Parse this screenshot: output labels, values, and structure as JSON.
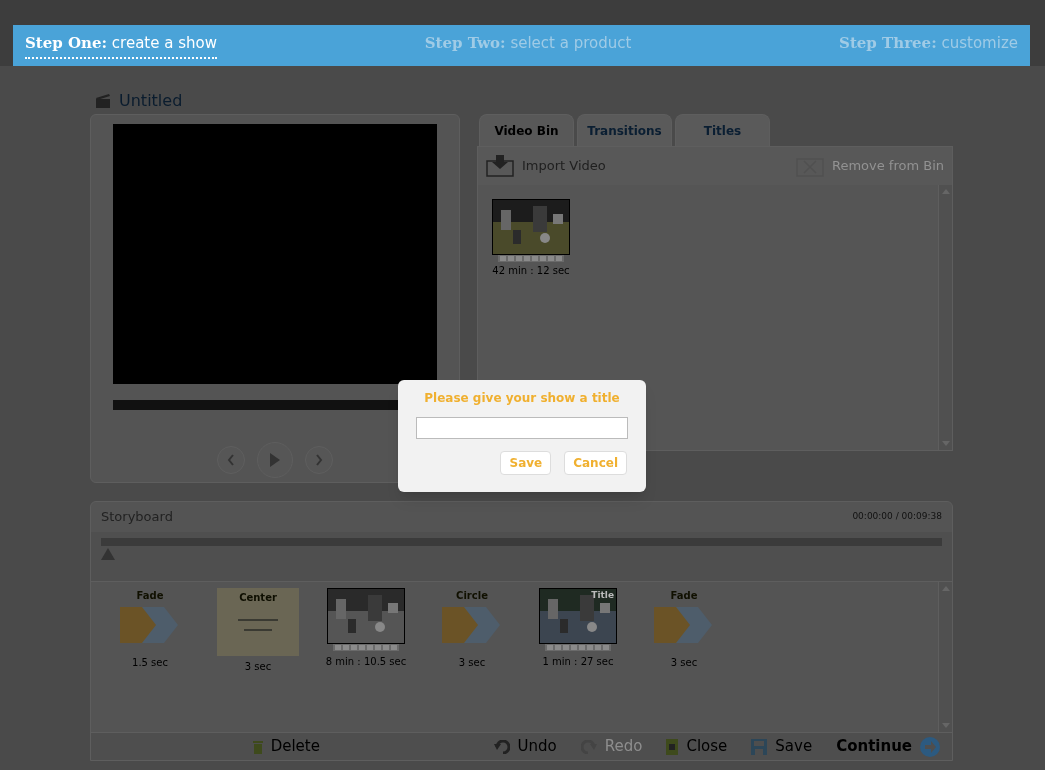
{
  "steps": [
    {
      "label": "Step One:",
      "detail": "create a show",
      "selected": true
    },
    {
      "label": "Step Two:",
      "detail": "select a product",
      "selected": false
    },
    {
      "label": "Step Three:",
      "detail": "customize",
      "selected": false
    }
  ],
  "show_title": "Untitled",
  "tabs": [
    {
      "label": "Video Bin",
      "selected": true
    },
    {
      "label": "Transitions",
      "selected": false
    },
    {
      "label": "Titles",
      "selected": false
    }
  ],
  "bin_toolbar": {
    "import": {
      "label": "Import Video",
      "disabled": false
    },
    "remove": {
      "label": "Remove from Bin",
      "disabled": true
    }
  },
  "bin_clips": [
    {
      "duration": "42 min : 12 sec"
    }
  ],
  "storyboard": {
    "title": "Storyboard",
    "time": "00:00:00 / 00:09:38",
    "items": [
      {
        "kind": "transition",
        "name": "Fade",
        "duration": "1.5 sec"
      },
      {
        "kind": "title_card",
        "name": "Center",
        "duration": "3 sec"
      },
      {
        "kind": "clip",
        "duration": "8 min : 10.5 sec"
      },
      {
        "kind": "transition",
        "name": "Circle",
        "duration": "3 sec"
      },
      {
        "kind": "clip",
        "badge": "Title",
        "duration": "1 min : 27 sec"
      },
      {
        "kind": "transition",
        "name": "Fade",
        "duration": "3 sec"
      }
    ]
  },
  "bottom_bar": {
    "delete": {
      "label": "Delete",
      "disabled": false
    },
    "undo": {
      "label": "Undo",
      "disabled": false
    },
    "redo": {
      "label": "Redo",
      "disabled": true
    },
    "close": {
      "label": "Close",
      "disabled": false
    },
    "save": {
      "label": "Save",
      "disabled": false
    },
    "continue": {
      "label": "Continue",
      "disabled": false
    }
  },
  "dialog": {
    "prompt": "Please give your show a title",
    "buttons": [
      "Save",
      "Cancel"
    ]
  }
}
